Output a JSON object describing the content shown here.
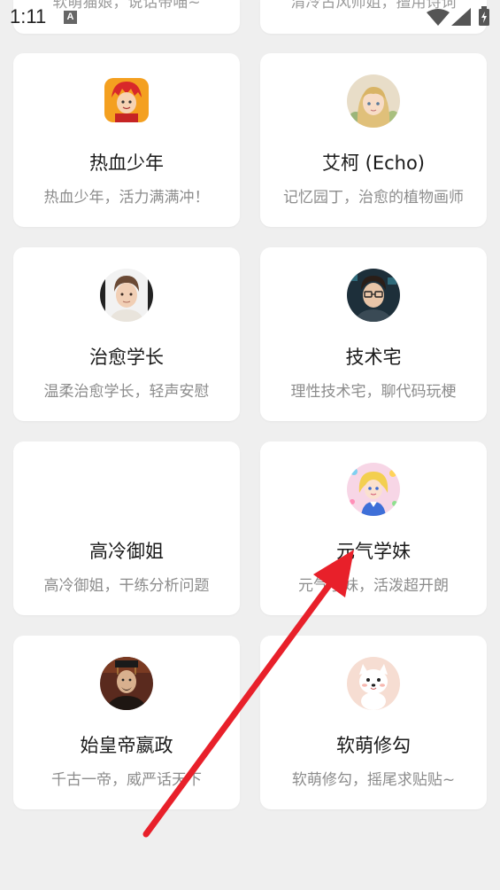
{
  "status_bar": {
    "time": "1:11",
    "notification_icon_letter": "A"
  },
  "cards": [
    {
      "name": "",
      "desc": "软萌猫娘，说话带喵~"
    },
    {
      "name": "",
      "desc": "清冷古风师姐，擅用诗词"
    },
    {
      "name": "热血少年",
      "desc": "热血少年，活力满满冲！",
      "avatar": "red-haired-boy-icon"
    },
    {
      "name": "艾柯 (Echo)",
      "desc": "记忆园丁，治愈的植物画师",
      "avatar": "blonde-girl-icon"
    },
    {
      "name": "治愈学长",
      "desc": "温柔治愈学长，轻声安慰",
      "avatar": "gentle-senior-icon"
    },
    {
      "name": "技术宅",
      "desc": "理性技术宅，聊代码玩梗",
      "avatar": "glasses-techie-icon"
    },
    {
      "name": "高冷御姐",
      "desc": "高冷御姐，干练分析问题",
      "avatar": ""
    },
    {
      "name": "元气学妹",
      "desc": "元气学妹，活泼超开朗",
      "avatar": "cheerful-girl-icon"
    },
    {
      "name": "始皇帝嬴政",
      "desc": "千古一帝，威严话天下",
      "avatar": "emperor-icon"
    },
    {
      "name": "软萌修勾",
      "desc": "软萌修勾，摇尾求贴贴~",
      "avatar": "puppy-icon"
    }
  ],
  "colors": {
    "background": "#efefef",
    "card": "#ffffff",
    "arrow": "#e8202a"
  }
}
